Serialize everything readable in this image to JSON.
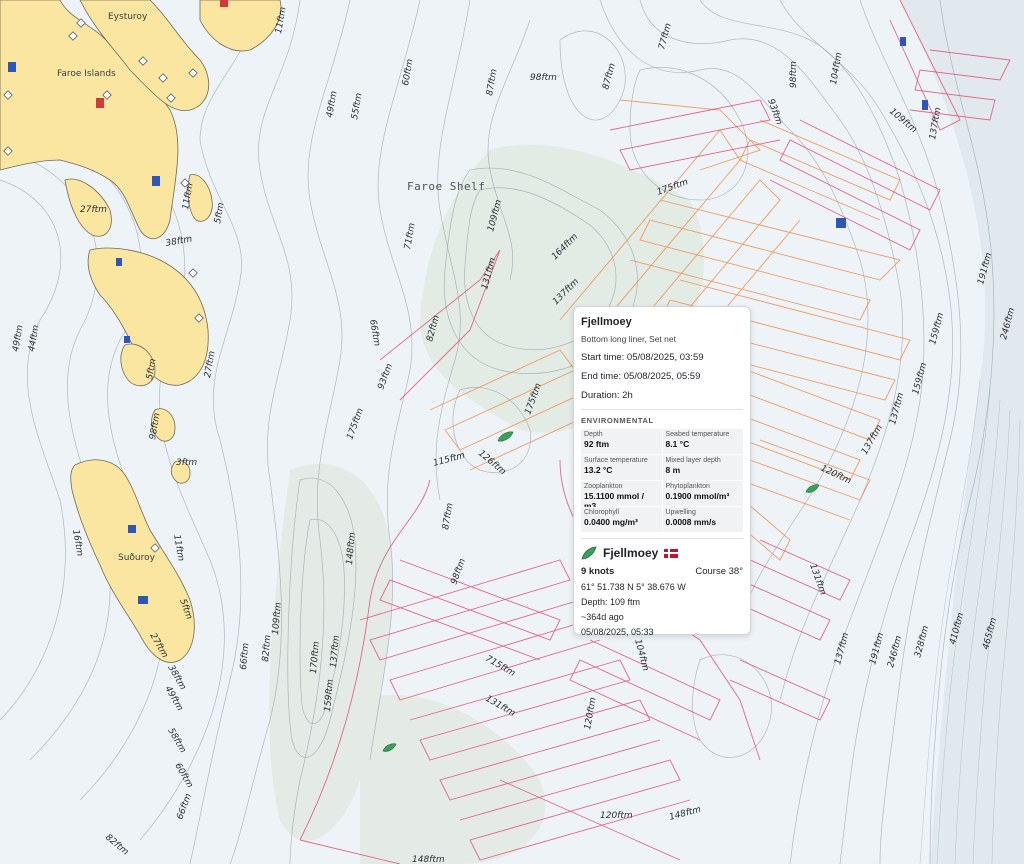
{
  "map": {
    "region_label": "Faroe Shelf",
    "places": [
      "Eysturoy",
      "Faroe Islands",
      "Suðuroy"
    ],
    "depth_labels": [
      "11ftm",
      "60ftm",
      "55ftm",
      "49ftm",
      "87ftm",
      "98ftm",
      "87ftm",
      "77ftm",
      "98ftm",
      "93ftm",
      "104ftm",
      "109ftm",
      "137ftm",
      "27ftm",
      "38ftm",
      "11ftm",
      "5ftm",
      "71ftm",
      "109ftm",
      "175ftm",
      "164ftm",
      "131ftm",
      "137ftm",
      "66ftm",
      "44ftm",
      "49ftm",
      "27ftm",
      "5ftm",
      "98ftm",
      "82ftm",
      "93ftm",
      "175ftm",
      "115ftm",
      "126ftm",
      "3ftm",
      "87ftm",
      "148ftm",
      "16ftm",
      "11ftm",
      "98ftm",
      "5ftm",
      "27ftm",
      "38ftm",
      "49ftm",
      "66ftm",
      "82ftm",
      "109ftm",
      "170ftm",
      "137ftm",
      "159ftm",
      "715ftm",
      "131ftm",
      "104ftm",
      "120ftm",
      "131ftm",
      "137ftm",
      "159ftm",
      "191ftm",
      "246ftm",
      "328ftm",
      "410ftm",
      "465ftm",
      "120ftm",
      "148ftm",
      "148ftm",
      "60ftm",
      "66ftm",
      "82ftm",
      "71ftm",
      "58ftm"
    ],
    "colors": {
      "land": "#fae6a0",
      "water": "#e9f0f6",
      "shelf": "#e2eae6",
      "track_orange": "#f08c4a",
      "track_red": "#e0456e",
      "vessel": "#3aa15a"
    }
  },
  "popup": {
    "title": "Fjellmoey",
    "gear": "Bottom long liner, Set net",
    "start": "Start time: 05/08/2025, 03:59",
    "end": "End time: 05/08/2025, 05:59",
    "duration": "Duration: 2h",
    "env_heading": "ENVIRONMENTAL",
    "env": [
      {
        "k": "Depth",
        "v": "92 ftm"
      },
      {
        "k": "Seabed temperature",
        "v": "8.1 °C"
      },
      {
        "k": "Surface temperature",
        "v": "13.2 °C"
      },
      {
        "k": "Mixed layer depth",
        "v": "8 m"
      },
      {
        "k": "Zooplankton",
        "v": "15.1100 mmol / m3"
      },
      {
        "k": "Phytoplankton",
        "v": "0.1900 mmol/m³"
      },
      {
        "k": "Chlorophyll",
        "v": "0.0400 mg/m³"
      },
      {
        "k": "Upwelling",
        "v": "0.0008 mm/s"
      }
    ],
    "vessel_name": "Fjellmoey",
    "flag_icon": "norway-flag-icon",
    "vessel_icon": "vessel-leaf-icon",
    "speed": "9 knots",
    "course": "Course 38°",
    "position": "61° 51.738 N 5° 38.676 W",
    "depth": "Depth: 109 ftm",
    "ago": "~364d ago",
    "timestamp": "05/08/2025, 05:33"
  }
}
